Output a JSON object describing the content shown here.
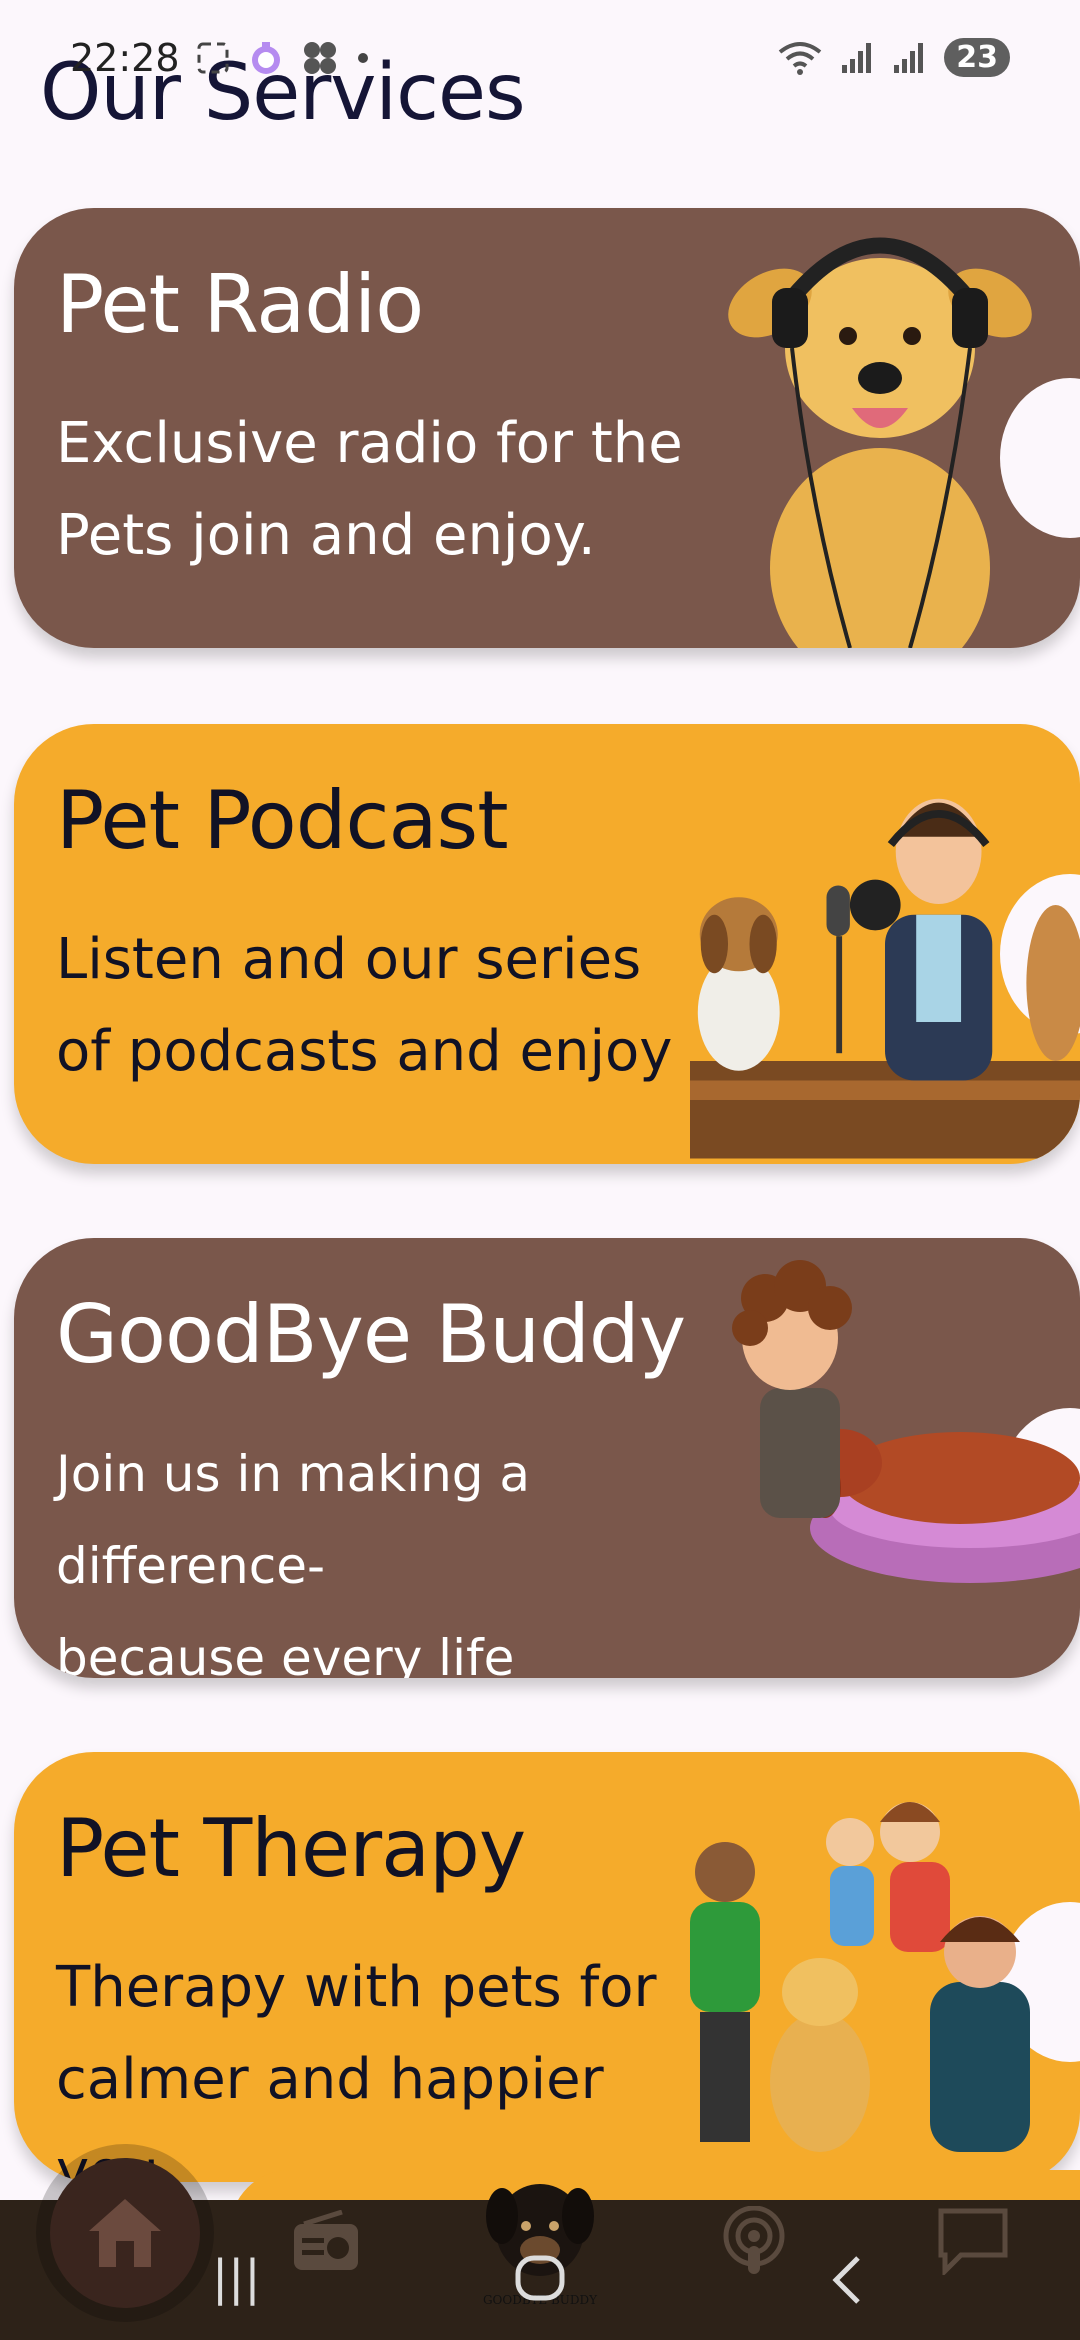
{
  "status_bar": {
    "time": "22:28",
    "battery": "23"
  },
  "page": {
    "title": "Our Services"
  },
  "cards": [
    {
      "title": "Pet Radio",
      "desc": "Exclusive radio for the\nPets join and enjoy.",
      "color": "#7a574b"
    },
    {
      "title": "Pet Podcast",
      "desc": "Listen and our series\n of podcasts and enjoy",
      "color": "#f5ab2b"
    },
    {
      "title": "GoodBye Buddy",
      "desc": "Join us in making a difference-\n because every life matters.",
      "color": "#7a574b"
    },
    {
      "title": "Pet Therapy",
      "desc": "Therapy with pets for\ncalmer and happier you",
      "color": "#f5ab2b"
    }
  ],
  "bottom_nav": {
    "items": [
      "home-icon",
      "radio-icon",
      "goodbye-buddy-logo",
      "podcast-icon",
      "chat-icon"
    ],
    "logo_text": "GOODBYE BUDDY"
  },
  "system_nav": {
    "recents": "|||",
    "home": "○",
    "back": "<"
  }
}
